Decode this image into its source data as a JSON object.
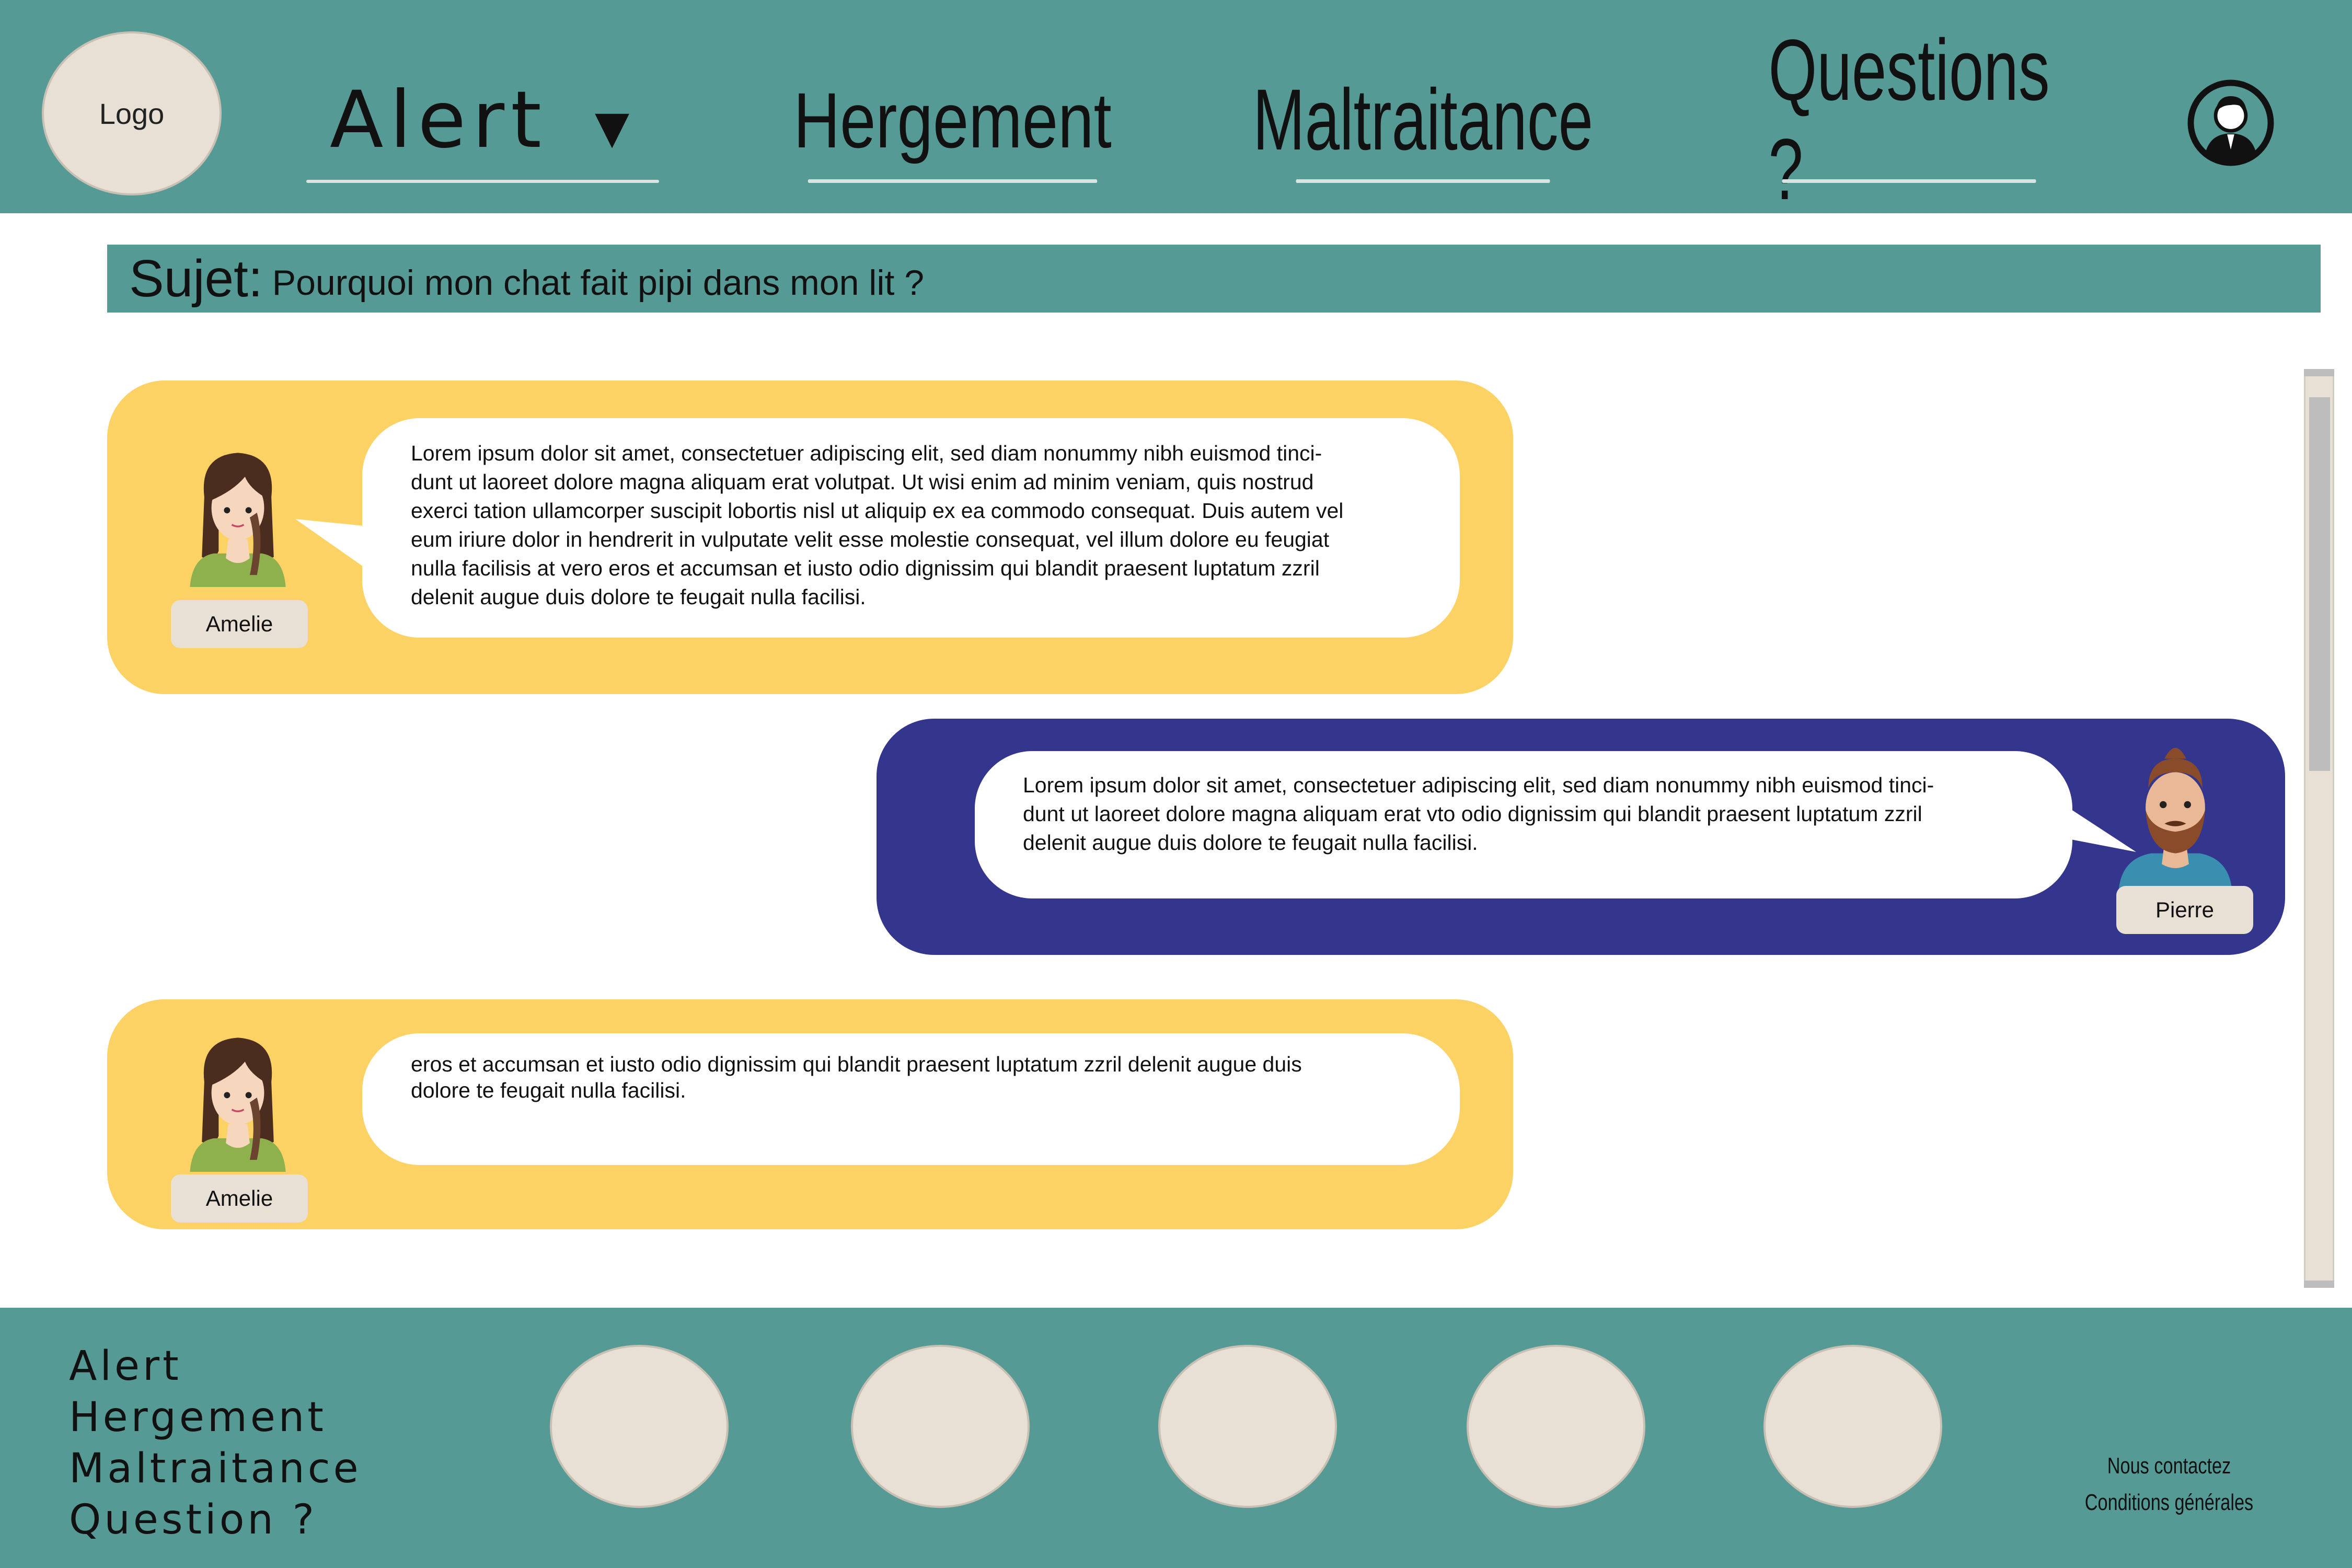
{
  "header": {
    "logo": "Logo",
    "nav": [
      {
        "label": "Alert"
      },
      {
        "label": "Hergement"
      },
      {
        "label": "Maltraitance"
      },
      {
        "label": "Questions ?"
      }
    ],
    "dropdown_icon": "caret-down-icon",
    "profile_icon": "user-profile-icon"
  },
  "subject": {
    "label": "Sujet:",
    "text": "Pourquoi mon chat fait pipi dans mon lit ?"
  },
  "messages": [
    {
      "author": "Amelie",
      "lines": [
        "Lorem ipsum dolor sit amet, consectetuer adipiscing elit, sed diam nonummy nibh euismod tinci-",
        "dunt ut laoreet dolore magna aliquam erat volutpat. Ut wisi enim ad minim veniam, quis nostrud",
        "exerci tation ullamcorper suscipit lobortis nisl ut aliquip ex ea commodo consequat. Duis autem vel",
        "eum iriure dolor in hendrerit in vulputate velit esse molestie consequat, vel illum dolore eu feugiat",
        "nulla facilisis at vero eros et accumsan et iusto odio dignissim qui blandit praesent luptatum zzril",
        "delenit augue duis dolore te feugait nulla facilisi."
      ]
    },
    {
      "author": "Pierre",
      "lines": [
        "Lorem ipsum dolor sit amet, consectetuer adipiscing elit, sed diam nonummy nibh euismod tinci-",
        "dunt ut laoreet dolore magna aliquam erat vto odio dignissim qui blandit praesent luptatum zzril",
        "delenit augue duis dolore te feugait nulla facilisi."
      ]
    },
    {
      "author": "Amelie",
      "lines": [
        "eros et accumsan et iusto odio dignissim qui blandit praesent luptatum zzril delenit augue duis",
        "dolore te feugait nulla facilisi."
      ]
    }
  ],
  "footer": {
    "links": [
      "Alert",
      "Hergement",
      "Maltraitance",
      "Question ?"
    ],
    "contact": "Nous contactez",
    "terms": "Conditions générales"
  },
  "colors": {
    "teal": "#569a96",
    "yellow": "#fdd264",
    "navy": "#34358d",
    "beige": "#e8e0d5"
  }
}
